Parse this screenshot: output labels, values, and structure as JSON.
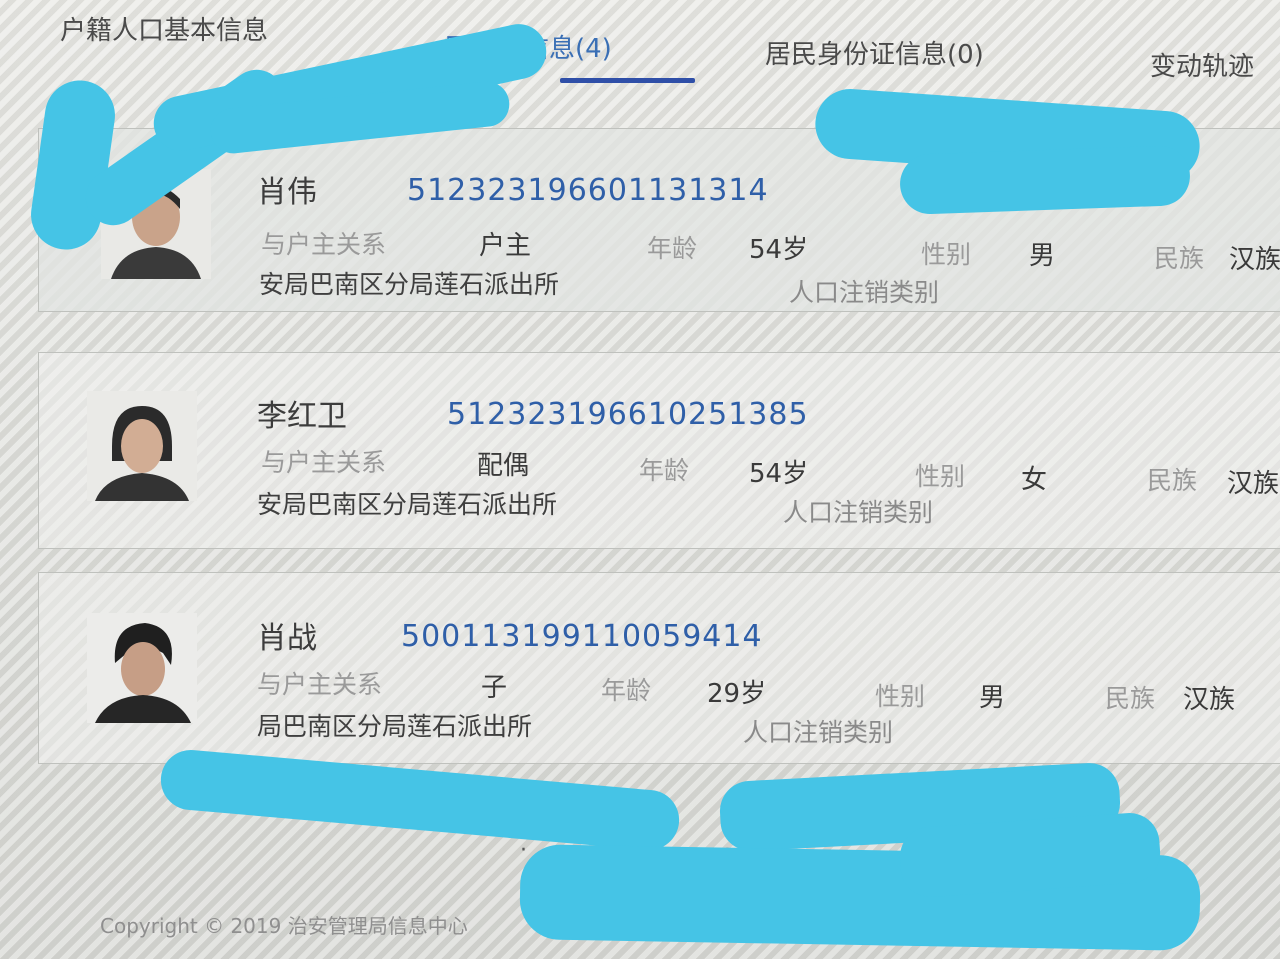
{
  "tabs": [
    {
      "label": "户籍人口基本信息",
      "active": false
    },
    {
      "label": "同户人信息(4)",
      "active": true
    },
    {
      "label": "居民身份证信息(0)",
      "active": false
    },
    {
      "label": "变动轨迹",
      "active": false
    }
  ],
  "labels": {
    "relation": "与户主关系",
    "age": "年龄",
    "gender": "性别",
    "ethnicity": "民族"
  },
  "members": [
    {
      "name": "肖伟",
      "id_number": "512323196601131314",
      "relation": "户主",
      "age": "54岁",
      "gender": "男",
      "ethnicity": "汉族",
      "station": "安局巴南区分局莲石派出所",
      "status": "人口注销类别"
    },
    {
      "name": "李红卫",
      "id_number": "512323196610251385",
      "relation": "配偶",
      "age": "54岁",
      "gender": "女",
      "ethnicity": "汉族",
      "station": "安局巴南区分局莲石派出所",
      "status": "人口注销类别"
    },
    {
      "name": "肖战",
      "id_number": "500113199110059414",
      "relation": "子",
      "age": "29岁",
      "gender": "男",
      "ethnicity": "汉族",
      "station": "局巴南区分局莲石派出所",
      "status": "人口注销类别"
    }
  ],
  "footer": {
    "copyright": "Copyright © 2019 治安管理局信息中心"
  },
  "colors": {
    "accent": "#2f4fa8",
    "id_blue": "#2f5fa8",
    "redaction": "#45c4e6"
  }
}
